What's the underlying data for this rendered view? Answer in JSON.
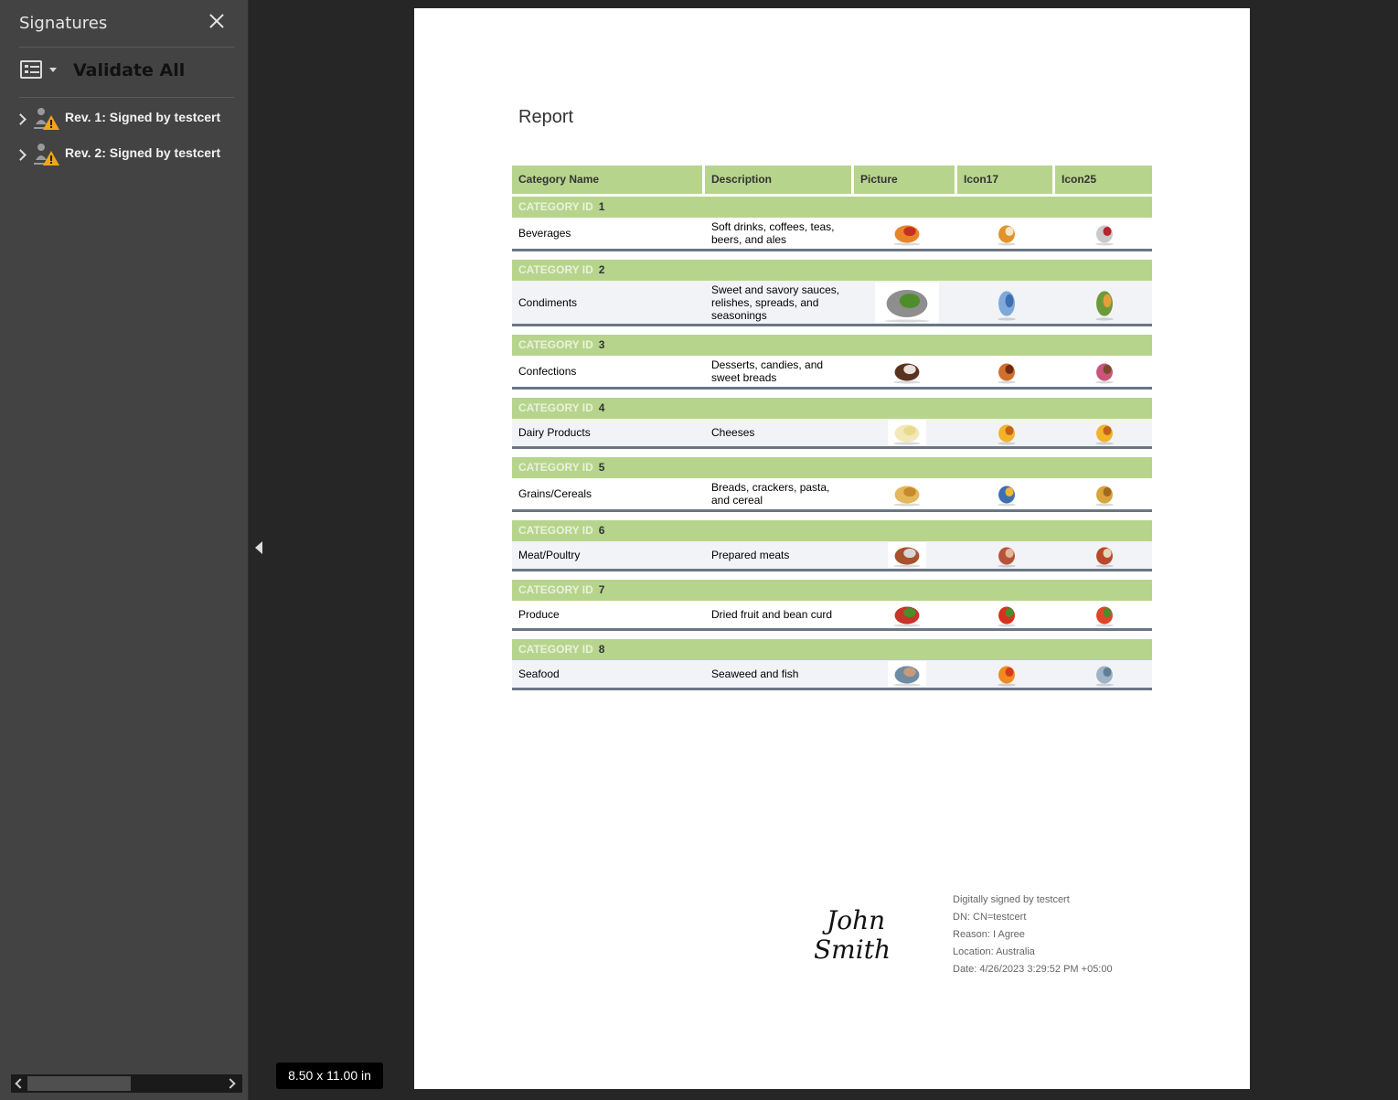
{
  "sidebar": {
    "title": "Signatures",
    "validate_label": "Validate All",
    "revisions": [
      {
        "label": "Rev. 1: Signed by testcert"
      },
      {
        "label": "Rev. 2: Signed by testcert"
      }
    ]
  },
  "viewer": {
    "page_size": "8.50 x 11.00 in"
  },
  "report": {
    "title": "Report",
    "columns": [
      "Category Name",
      "Description",
      "Picture",
      "Icon17",
      "Icon25"
    ],
    "group_label": "CATEGORY ID",
    "rows": [
      {
        "id": "1",
        "name": "Beverages",
        "description": "Soft drinks, coffees, teas, beers, and ales",
        "picture": "beverages-picture",
        "icon17": "beer-mug-icon",
        "icon25": "teacup-icon"
      },
      {
        "id": "2",
        "name": "Condiments",
        "description": "Sweet and savory sauces, relishes, spreads, and seasonings",
        "picture": "mortar-herbs-picture",
        "icon17": "salt-shaker-icon",
        "icon25": "spice-jars-icon"
      },
      {
        "id": "3",
        "name": "Confections",
        "description": "Desserts, candies, and sweet breads",
        "picture": "chocolates-picture",
        "icon17": "cake-slice-icon",
        "icon25": "pie-slice-icon"
      },
      {
        "id": "4",
        "name": "Dairy Products",
        "description": "Cheeses",
        "picture": "cheese-picture",
        "icon17": "cheese-wedge-icon",
        "icon25": "cheese-wedge-icon"
      },
      {
        "id": "5",
        "name": "Grains/Cereals",
        "description": "Breads, crackers, pasta, and cereal",
        "picture": "bread-picture",
        "icon17": "cereal-bowl-icon",
        "icon25": "wheat-icon"
      },
      {
        "id": "6",
        "name": "Meat/Poultry",
        "description": "Prepared meats",
        "picture": "roast-chicken-picture",
        "icon17": "ham-icon",
        "icon25": "drumstick-icon"
      },
      {
        "id": "7",
        "name": "Produce",
        "description": "Dried fruit and bean curd",
        "picture": "vegetables-picture",
        "icon17": "apple-icon",
        "icon25": "tomato-icon"
      },
      {
        "id": "8",
        "name": "Seafood",
        "description": "Seaweed and fish",
        "picture": "fish-picture",
        "icon17": "goldfish-icon",
        "icon25": "fish-icon"
      }
    ]
  },
  "signature": {
    "handwritten": "John Smith",
    "lines": [
      "Digitally signed by testcert",
      "DN: CN=testcert",
      "Reason: I Agree",
      "Location: Australia",
      "Date: 4/26/2023 3:29:52 PM +05:00"
    ]
  }
}
